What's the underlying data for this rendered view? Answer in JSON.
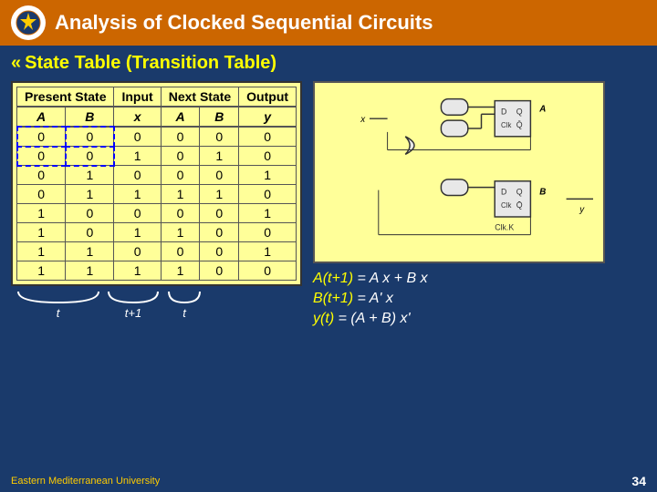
{
  "header": {
    "logo_text": "★",
    "title": "Analysis of Clocked Sequential Circuits"
  },
  "section": {
    "bullet": "«",
    "heading": "State Table (Transition Table)"
  },
  "table": {
    "header_row1": {
      "present_state": "Present State",
      "input": "Input",
      "next_state": "Next State",
      "output": "Output"
    },
    "header_row2": {
      "A": "A",
      "B": "B",
      "x": "x",
      "nA": "A",
      "nB": "B",
      "y": "y"
    },
    "rows": [
      [
        "0",
        "0",
        "0",
        "0",
        "0",
        "0"
      ],
      [
        "0",
        "0",
        "1",
        "0",
        "1",
        "0"
      ],
      [
        "0",
        "1",
        "0",
        "0",
        "0",
        "1"
      ],
      [
        "0",
        "1",
        "1",
        "1",
        "1",
        "0"
      ],
      [
        "1",
        "0",
        "0",
        "0",
        "0",
        "1"
      ],
      [
        "1",
        "0",
        "1",
        "1",
        "0",
        "0"
      ],
      [
        "1",
        "1",
        "0",
        "0",
        "0",
        "1"
      ],
      [
        "1",
        "1",
        "1",
        "1",
        "0",
        "0"
      ]
    ]
  },
  "braces": {
    "t_label": "t",
    "t1_label": "t+1",
    "t2_label": "t"
  },
  "equations": [
    {
      "label": "A(t+1)",
      "eq": " = A x + B x"
    },
    {
      "label": "B(t+1)",
      "eq": " = A' x"
    },
    {
      "label": "y(t) ",
      "eq": " = (A + B) x'"
    }
  ],
  "footer": {
    "university": "Eastern Mediterranean University",
    "page": "34"
  }
}
